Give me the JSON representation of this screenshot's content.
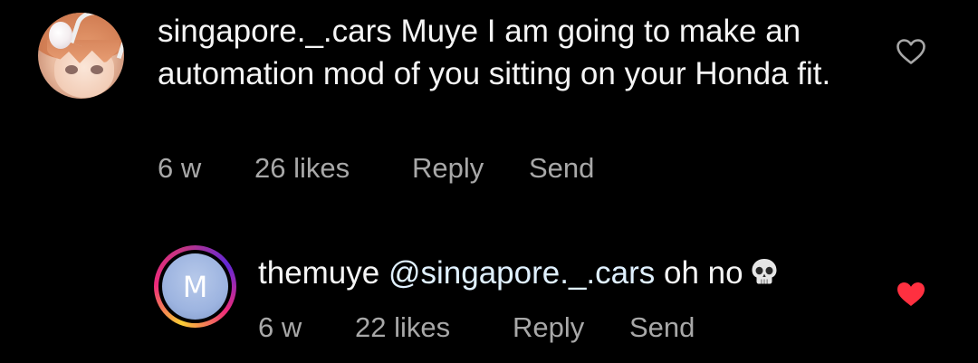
{
  "comments": [
    {
      "username": "singapore._.cars",
      "text": "Muye I am going to make an automation mod of you sitting on your Honda fit.",
      "time": "6 w",
      "likes": "26 likes",
      "reply_label": "Reply",
      "send_label": "Send",
      "liked": false,
      "heart_color": "#a8a8a8"
    },
    {
      "username": "themuye",
      "mention": "@singapore._.cars",
      "text": "oh no",
      "emoji": "skull",
      "avatar_letter": "M",
      "time": "6 w",
      "likes": "22 likes",
      "reply_label": "Reply",
      "send_label": "Send",
      "liked": true,
      "heart_color": "#ff3040"
    }
  ],
  "colors": {
    "background": "#000000",
    "primary_text": "#f5f5f5",
    "secondary_text": "#a8a8a8",
    "mention": "#e0f1ff",
    "liked_heart": "#ff3040"
  }
}
